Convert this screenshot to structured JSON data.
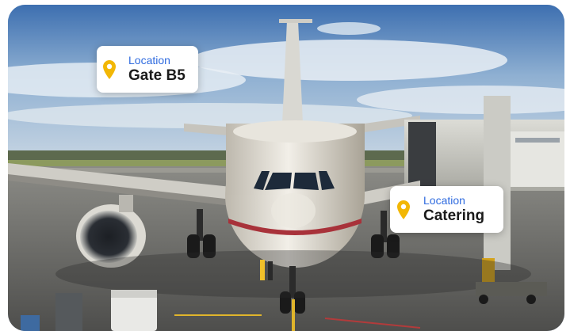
{
  "location_tags": [
    {
      "label": "Location",
      "value": "Gate B5",
      "icon": "map-pin-icon"
    },
    {
      "label": "Location",
      "value": "Catering",
      "icon": "map-pin-icon"
    }
  ],
  "colors": {
    "label_accent": "#2f6bdf",
    "pin": "#f2b705",
    "card_background": "#ffffff"
  }
}
